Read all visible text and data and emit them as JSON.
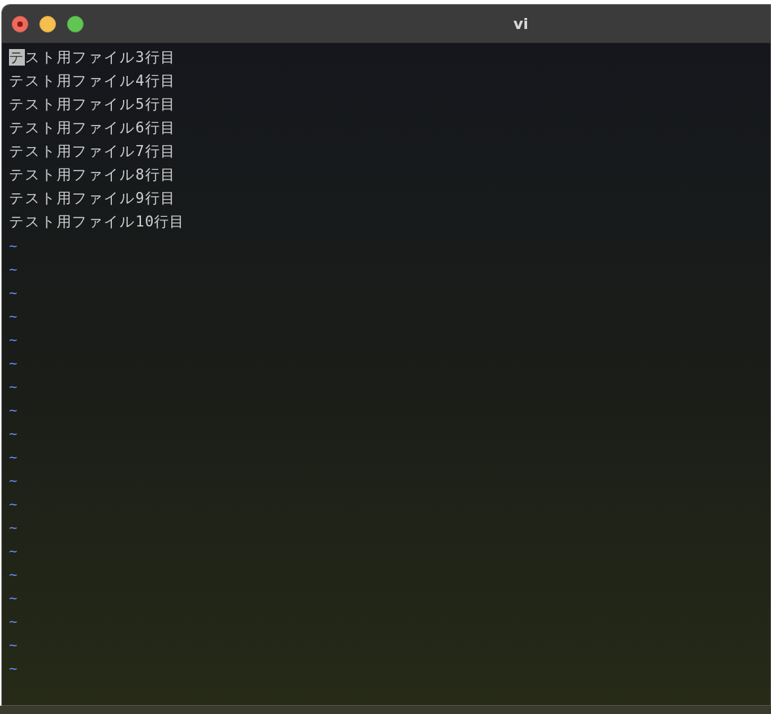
{
  "window": {
    "title": "vi"
  },
  "lines": [
    {
      "text": "テスト用ファイル3行目",
      "cursor": true
    },
    {
      "text": "テスト用ファイル4行目",
      "cursor": false
    },
    {
      "text": "テスト用ファイル5行目",
      "cursor": false
    },
    {
      "text": "テスト用ファイル6行目",
      "cursor": false
    },
    {
      "text": "テスト用ファイル7行目",
      "cursor": false
    },
    {
      "text": "テスト用ファイル8行目",
      "cursor": false
    },
    {
      "text": "テスト用ファイル9行目",
      "cursor": false
    },
    {
      "text": "テスト用ファイル10行目",
      "cursor": false
    }
  ],
  "empty_line_markers": [
    "~",
    "~",
    "~",
    "~",
    "~",
    "~",
    "~",
    "~",
    "~",
    "~",
    "~",
    "~",
    "~",
    "~",
    "~",
    "~",
    "~",
    "~",
    "~"
  ]
}
